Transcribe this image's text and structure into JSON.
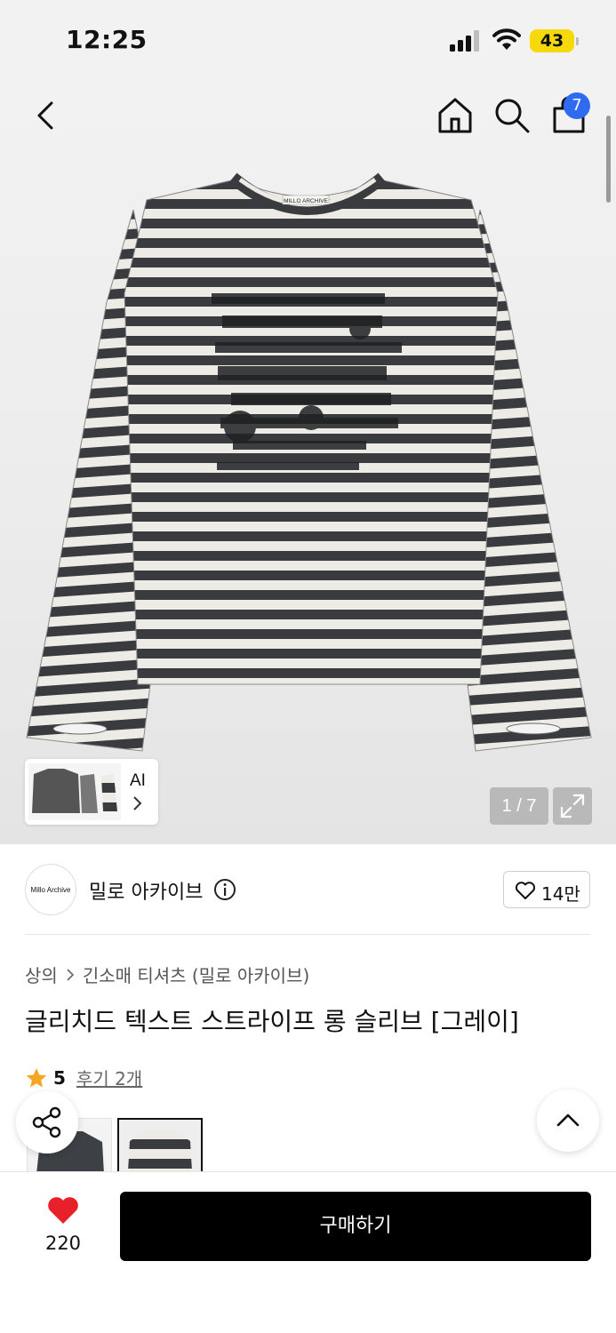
{
  "status_bar": {
    "time": "12:25",
    "battery": "43"
  },
  "header": {
    "cart_count": "7"
  },
  "gallery": {
    "garment_label": "MILLO ARCHIVE",
    "ai_label": "AI",
    "page_indicator": "1 / 7"
  },
  "brand": {
    "logo_text": "Millo Archive",
    "name": "밀로 아카이브",
    "likes": "14만"
  },
  "breadcrumb": [
    "상의",
    "긴소매 티셔츠 (밀로 아카이브)"
  ],
  "product": {
    "title": "글리치드 텍스트 스트라이프 롱 슬리브 [그레이]",
    "rating": "5",
    "review_link": "후기 2개"
  },
  "bottom_bar": {
    "wish_count": "220",
    "buy_label": "구매하기"
  },
  "colors": {
    "accent_blue": "#2f6bf0",
    "heart_red": "#e8202a",
    "star": "#f5a623"
  },
  "icons": [
    "back-icon",
    "home-icon",
    "search-icon",
    "shopping-bag-icon",
    "expand-icon",
    "info-icon",
    "heart-outline-icon",
    "star-icon",
    "share-icon",
    "chevron-up-icon",
    "heart-filled-icon"
  ]
}
